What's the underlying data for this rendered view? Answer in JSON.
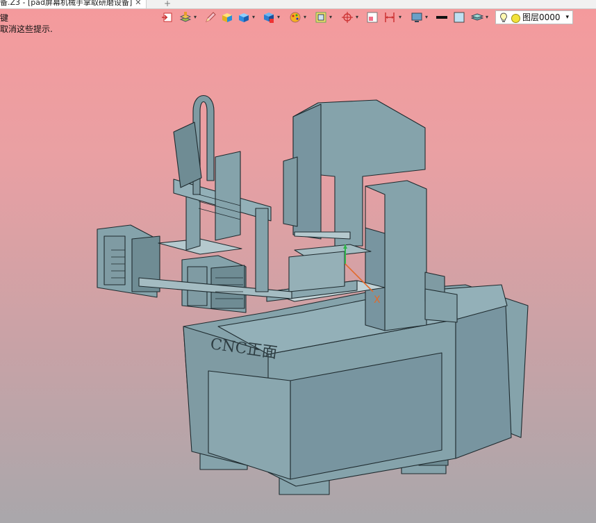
{
  "window": {
    "tab_title": "备.Z3 - [pad屏幕机械手掌取研磨设备]",
    "close_glyph": "✕",
    "new_tab_glyph": "+"
  },
  "hints": {
    "line1": "键",
    "line2": "取消这些提示."
  },
  "toolbar": {
    "icons": [
      "exit-sketch-icon",
      "layer-stack-icon",
      "pencil-icon",
      "box-shaded-icon",
      "box-blue-icon",
      "box-dropdown-icon",
      "palette-icon",
      "frame-icon",
      "axis-target-icon",
      "sketch-box-icon",
      "dimension-icon",
      "monitor-icon",
      "line-color-swatch",
      "fill-color-swatch",
      "layer-manager-icon"
    ],
    "dropdown_glyph": "▾"
  },
  "layer_select": {
    "value": "图层0000",
    "arrow": "▾"
  },
  "model": {
    "label": "CNC正面",
    "axis_x": "X",
    "color_body": "#85a3ab",
    "color_edge": "#1e2a2e",
    "color_shadow": "#6f8c94"
  }
}
